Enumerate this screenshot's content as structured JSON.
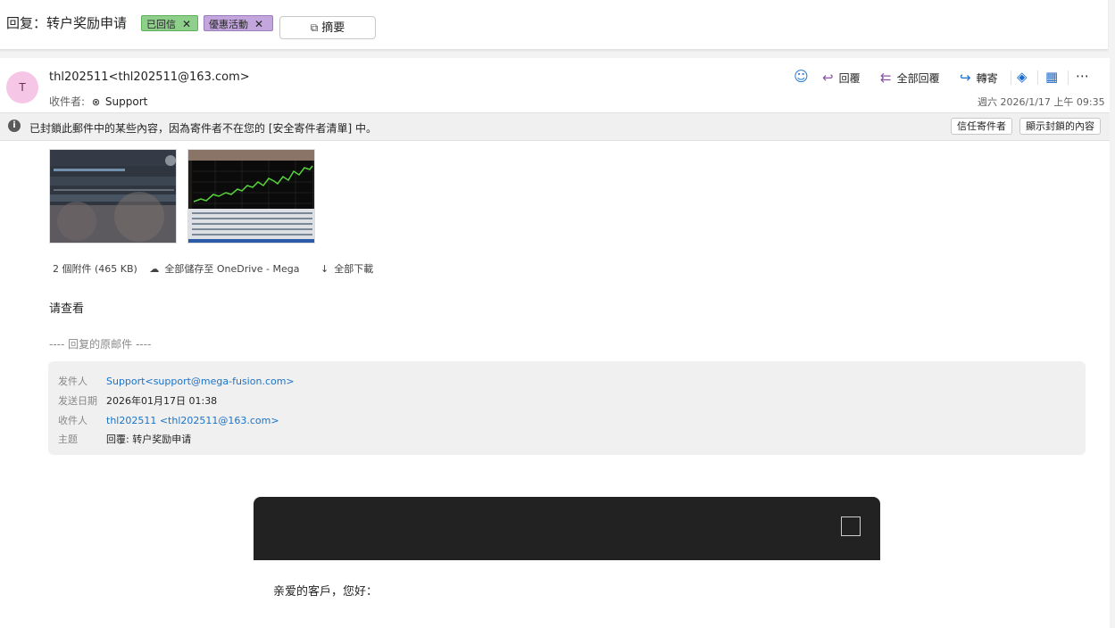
{
  "subject": {
    "title": "回复：转户奖励申请",
    "tags": [
      {
        "label": "已回信",
        "color": "#8ed08b"
      },
      {
        "label": "優惠活動",
        "color": "#c2a6dd"
      }
    ],
    "summary_button": "摘要"
  },
  "message": {
    "avatar_initial": "T",
    "sender": "thl202511<thl202511@163.com>",
    "to_label": "收件者:",
    "to_name": "Support",
    "datetime": "週六 2026/1/17 上午 09:35",
    "actions": {
      "reply": "回覆",
      "reply_all": "全部回覆",
      "forward": "轉寄"
    },
    "blocked_notice": "已封鎖此郵件中的某些內容，因為寄件者不在您的 [安全寄件者清單] 中。",
    "trust_sender_button": "信任寄件者",
    "show_blocked_button": "顯示封鎖的內容",
    "attachments": {
      "count_size": "2 個附件 (465 KB)",
      "save_onedrive": "全部儲存至 OneDrive - Mega",
      "download_all": "全部下載"
    },
    "body": "请查看",
    "original_divider": "---- 回复的原邮件 ----",
    "original": {
      "from_label": "发件人",
      "from": "Support<support@mega-fusion.com>",
      "date_label": "发送日期",
      "date": "2026年01月17日 01:38",
      "to_label": "收件人",
      "to": "thl202511 <thl202511@163.com>",
      "subject_label": "主题",
      "subject": "回覆: 转户奖励申请"
    },
    "greeting": "亲爱的客戶，您好："
  },
  "colors": {
    "accent": "#1c6dd0",
    "banner": "#222222"
  }
}
